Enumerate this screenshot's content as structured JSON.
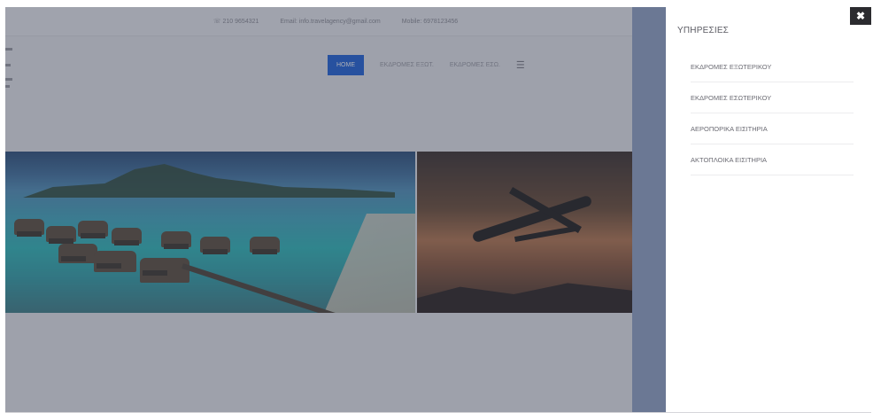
{
  "site": {
    "topbar": {
      "phone": "☏ 210 9654321",
      "email": "Email: info.travelagency@gmail.com",
      "mobile": "Mobile: 6978123456"
    },
    "nav": {
      "items": [
        {
          "label": "HOME",
          "active": true
        },
        {
          "label": "ΕΚΔΡΟΜΕΣ ΕΞΩΤ.",
          "active": false
        },
        {
          "label": "ΕΚΔΡΟΜΕΣ ΕΣΩ.",
          "active": false
        }
      ],
      "menu_icon": "hamburger-icon"
    },
    "hero_images": [
      "beach-resort-image",
      "airplane-sunset-image"
    ]
  },
  "panel": {
    "title": "ΥΠΗΡΕΣΙΕΣ",
    "close_icon": "close-icon",
    "close_glyph": "✖",
    "items": [
      {
        "label": "ΕΚΔΡΟΜΕΣ ΕΞΩΤΕΡΙΚΟΥ"
      },
      {
        "label": "ΕΚΔΡΟΜΕΣ ΕΣΩΤΕΡΙΚΟΥ"
      },
      {
        "label": "ΑΕΡΟΠΟΡΙΚΑ ΕΙΣΙΤΗΡΙΑ"
      },
      {
        "label": "ΑΚΤΟΠΛΟΙΚΑ ΕΙΣΙΤΗΡΙΑ"
      }
    ]
  },
  "colors": {
    "accent": "#1d5fd8",
    "overlay": "#373e50",
    "panel_bg": "#ffffff",
    "close_bg": "#2b2b2f"
  }
}
